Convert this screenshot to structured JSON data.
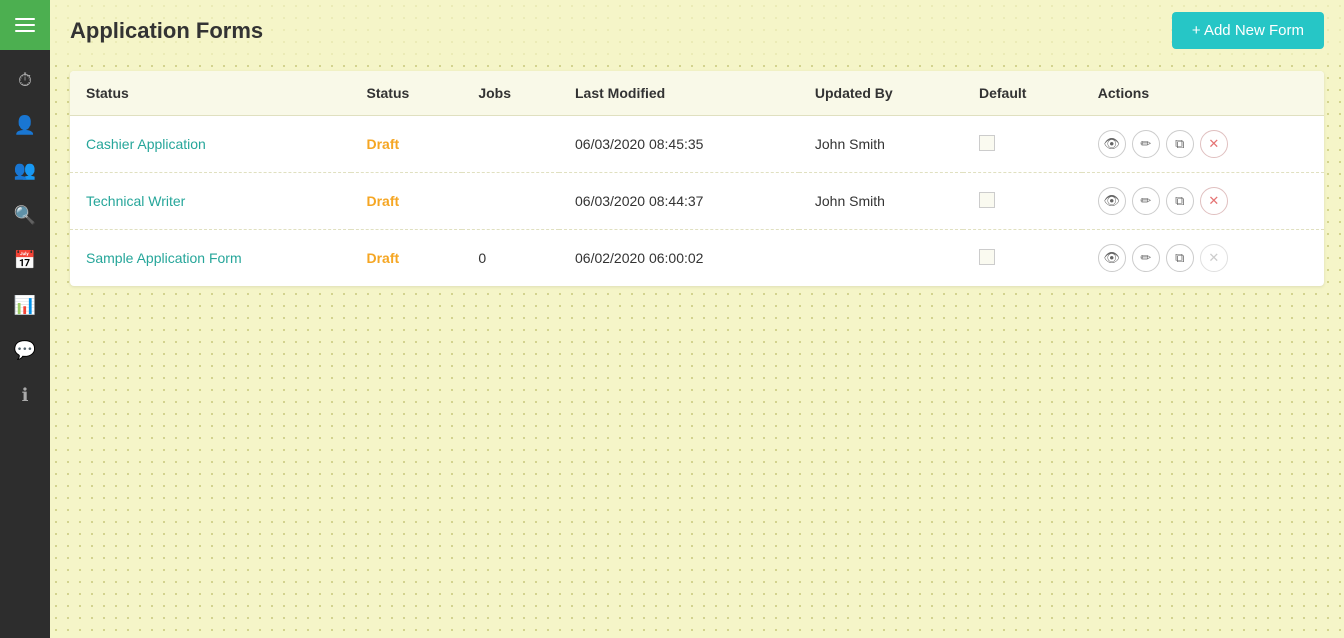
{
  "page": {
    "title": "Application Forms",
    "add_button_label": "+ Add New Form"
  },
  "table": {
    "headers": [
      "Status",
      "Status",
      "Jobs",
      "Last Modified",
      "Updated By",
      "Default",
      "Actions"
    ],
    "rows": [
      {
        "name": "Cashier Application",
        "status": "Draft",
        "jobs": "",
        "last_modified": "06/03/2020 08:45:35",
        "updated_by": "John Smith"
      },
      {
        "name": "Technical Writer",
        "status": "Draft",
        "jobs": "",
        "last_modified": "06/03/2020 08:44:37",
        "updated_by": "John Smith"
      },
      {
        "name": "Sample Application Form",
        "status": "Draft",
        "jobs": "0",
        "last_modified": "06/02/2020 06:00:02",
        "updated_by": ""
      }
    ]
  },
  "sidebar": {
    "icons": [
      {
        "name": "clock-icon",
        "symbol": "⏱"
      },
      {
        "name": "user-icon",
        "symbol": "👤"
      },
      {
        "name": "group-icon",
        "symbol": "👥"
      },
      {
        "name": "search-icon",
        "symbol": "🔍"
      },
      {
        "name": "calendar-icon",
        "symbol": "📅"
      },
      {
        "name": "chart-icon",
        "symbol": "📊"
      },
      {
        "name": "chat-icon",
        "symbol": "💬"
      },
      {
        "name": "info-icon",
        "symbol": "ℹ"
      }
    ]
  }
}
